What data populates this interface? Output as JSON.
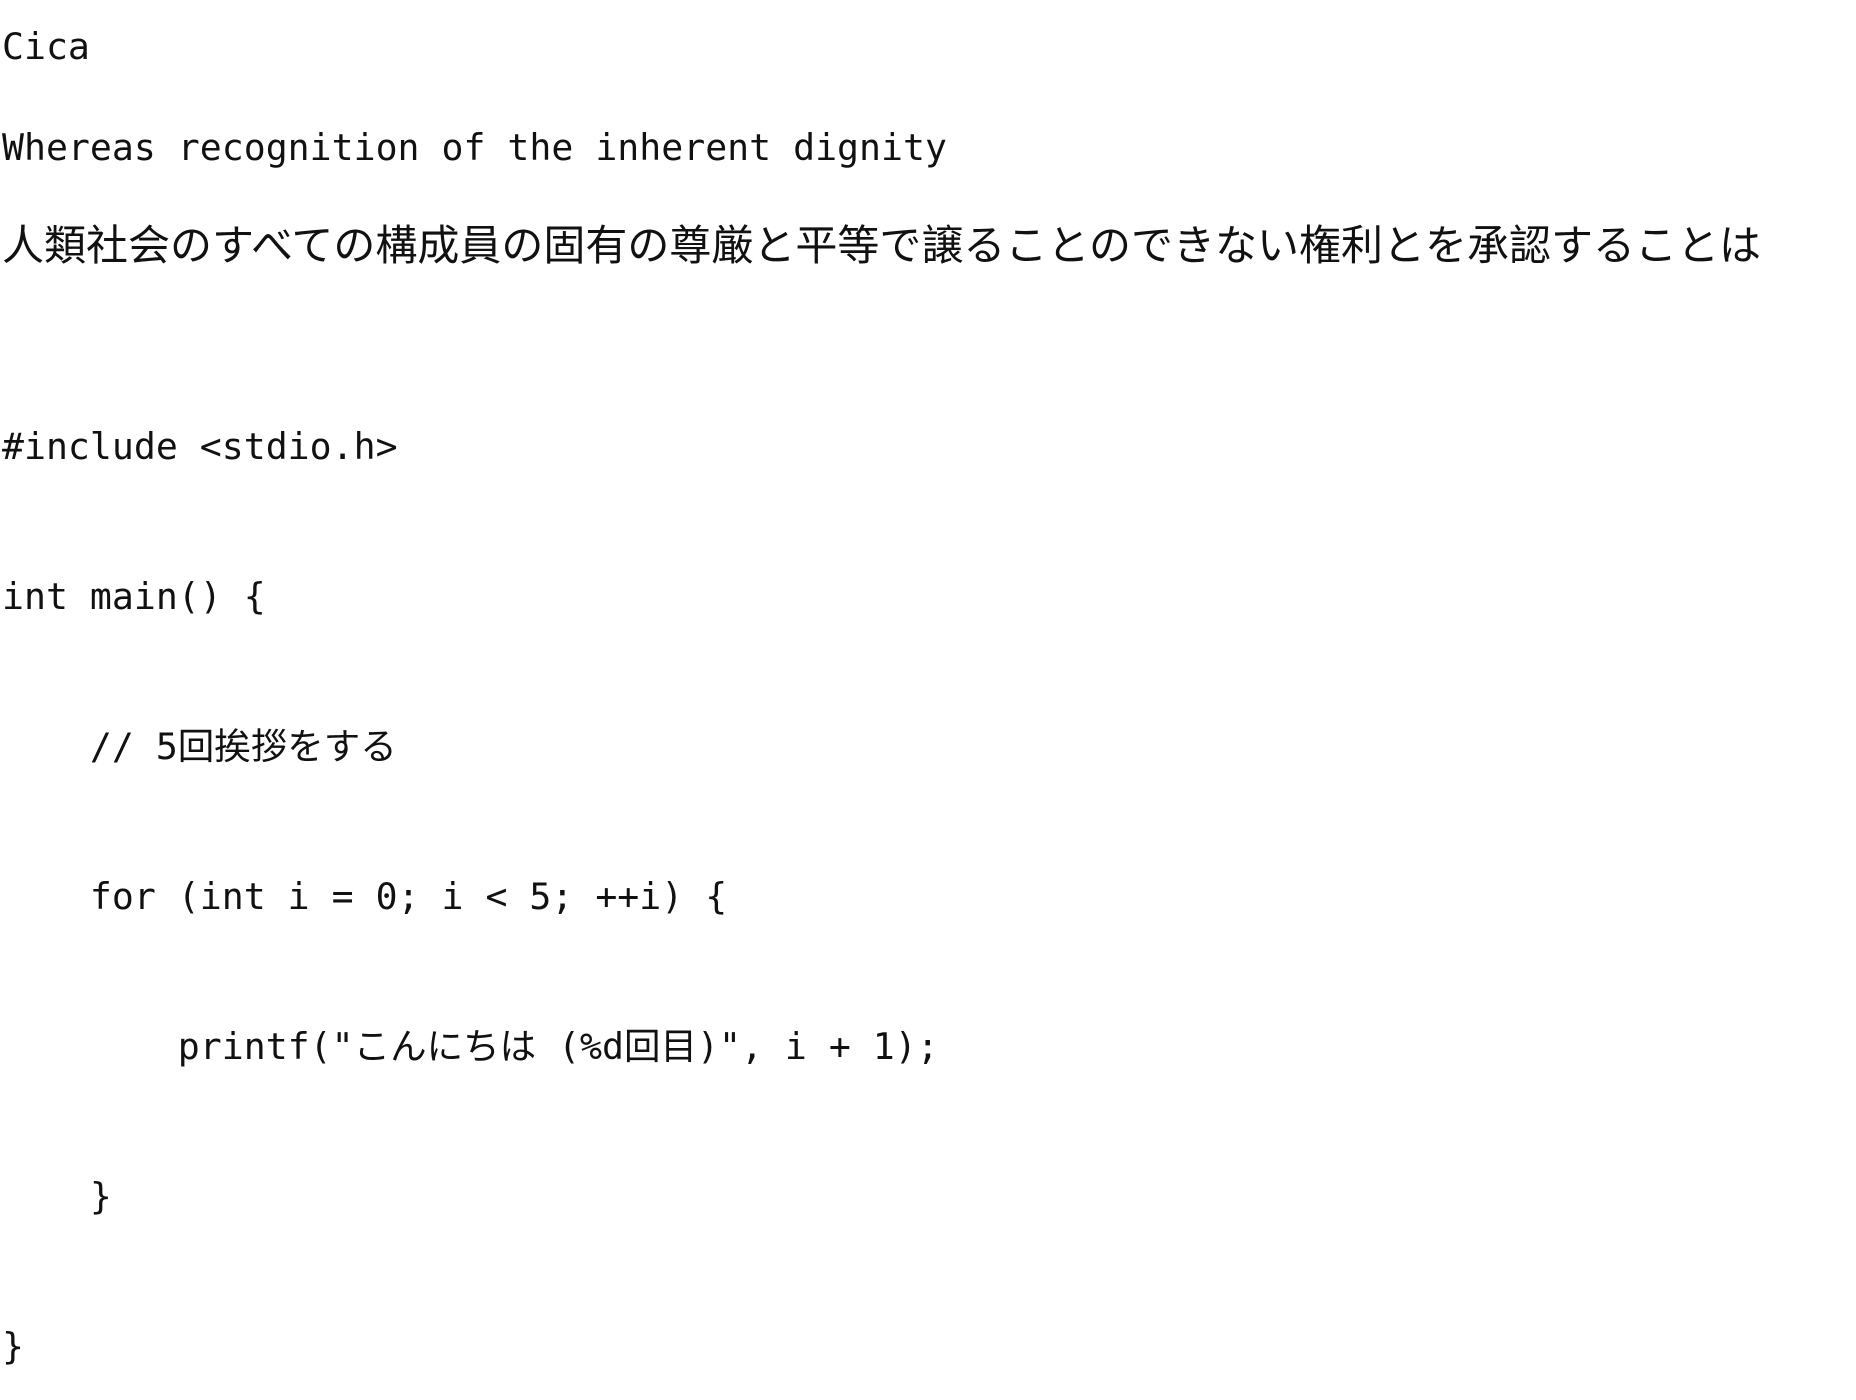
{
  "title": "Cica",
  "english_sample": "Whereas recognition of the inherent dignity",
  "japanese_sample": "人類社会のすべての構成員の固有の尊厳と平等で譲ることのできない権利とを承認することは",
  "code_lines": [
    "#include <stdio.h>",
    "int main() {",
    "    // 5回挨拶をする",
    "    for (int i = 0; i < 5; ++i) {",
    "        printf(\"こんにちは (%d回目)\", i + 1);",
    "    }",
    "}"
  ]
}
